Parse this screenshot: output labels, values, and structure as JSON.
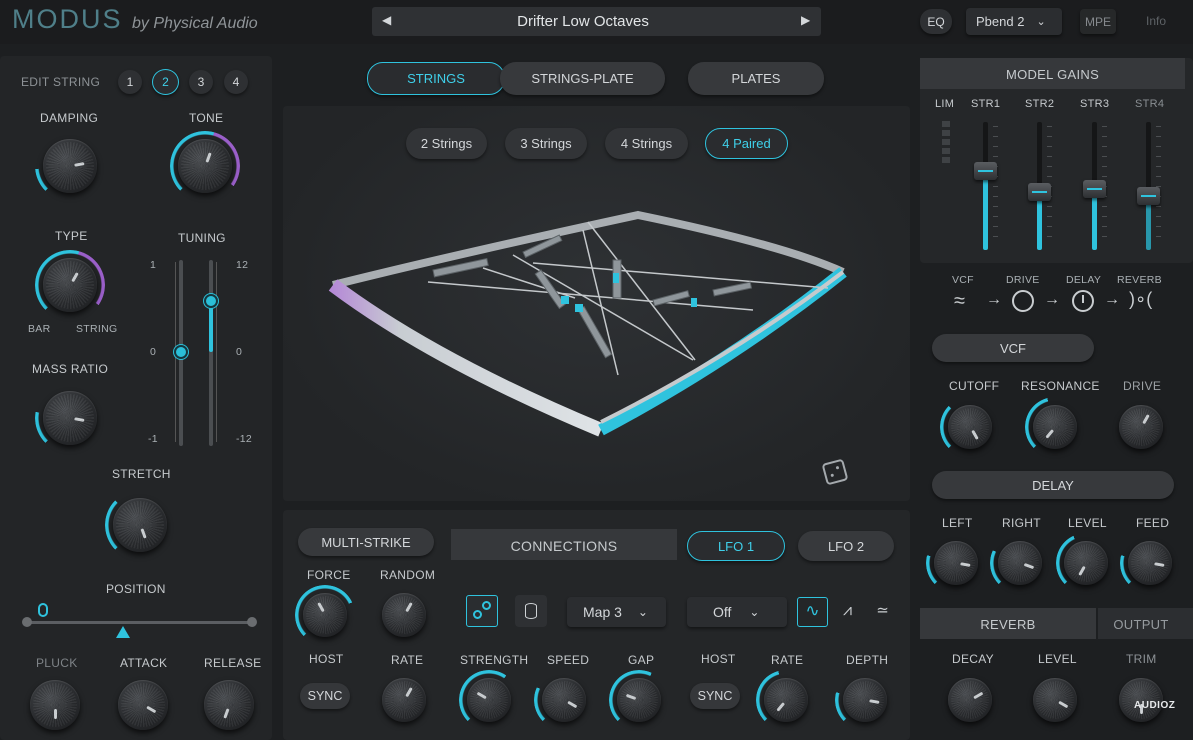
{
  "header": {
    "logo": "MODUS",
    "byline": "by Physical Audio",
    "preset_name": "Drifter Low Octaves",
    "prev_arrow": "◀",
    "next_arrow": "▶",
    "eq_label": "EQ",
    "pbend_label": "Pbend 2",
    "mpe_label": "MPE",
    "info_label": "Info"
  },
  "left": {
    "edit_string_label": "EDIT STRING",
    "strings": [
      "1",
      "2",
      "3",
      "4"
    ],
    "selected_string": "2",
    "damping": "DAMPING",
    "tone": "TONE",
    "type": "TYPE",
    "bar": "BAR",
    "string": "STRING",
    "tuning": "TUNING",
    "mass_ratio": "MASS RATIO",
    "stretch": "STRETCH",
    "position": "POSITION",
    "pluck": "PLUCK",
    "attack": "ATTACK",
    "release": "RELEASE",
    "scale_left": [
      "1",
      "0",
      "-1"
    ],
    "scale_right": [
      "12",
      "0",
      "-12"
    ]
  },
  "model_tabs": [
    "STRINGS",
    "STRINGS-PLATE",
    "PLATES"
  ],
  "string_tabs": [
    "2 Strings",
    "3 Strings",
    "4 Strings",
    "4 Paired"
  ],
  "bottom": {
    "multi_strike": "MULTI-STRIKE",
    "force": "FORCE",
    "random": "RANDOM",
    "host": "HOST",
    "rate": "RATE",
    "sync": "SYNC",
    "connections": "CONNECTIONS",
    "map": "Map 3",
    "strength": "STRENGTH",
    "speed": "SPEED",
    "gap": "GAP",
    "lfo1": "LFO 1",
    "lfo2": "LFO 2",
    "lfo_off": "Off",
    "lfo_host": "HOST",
    "lfo_rate": "RATE",
    "depth": "DEPTH",
    "lfo_sync": "SYNC"
  },
  "right": {
    "model_gains": "MODEL GAINS",
    "lim": "LIM",
    "channels": [
      "STR1",
      "STR2",
      "STR3",
      "STR4"
    ],
    "chain": [
      "VCF",
      "DRIVE",
      "DELAY",
      "REVERB"
    ],
    "vcf": "VCF",
    "cutoff": "CUTOFF",
    "resonance": "RESONANCE",
    "drive": "DRIVE",
    "delay": "DELAY",
    "left": "LEFT",
    "right": "RIGHT",
    "level": "LEVEL",
    "feed": "FEED",
    "reverb": "REVERB",
    "output": "OUTPUT",
    "decay": "DECAY",
    "rev_level": "LEVEL",
    "trim": "TRIM",
    "watermark": "AUDIOZ"
  },
  "colors": {
    "accent": "#2fc3de",
    "purple": "#9a5fc9",
    "bg": "#1d1f21",
    "panel": "#252729"
  },
  "gain_levels": [
    0.62,
    0.45,
    0.48,
    0.42
  ]
}
